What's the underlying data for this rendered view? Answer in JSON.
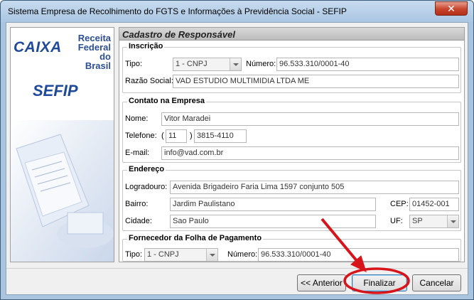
{
  "window": {
    "title": "Sistema Empresa de Recolhimento do FGTS e Informações à Previdência Social - SEFIP",
    "close": "✕"
  },
  "logo": {
    "caixa": "CAIXA",
    "receita_line1": "Receita",
    "receita_line2": "Federal",
    "receita_line3": "do",
    "receita_line4": "Brasil",
    "sefip": "SEFIP"
  },
  "panel": {
    "title": "Cadastro de Responsável"
  },
  "inscricao": {
    "legend": "Inscrição",
    "tipo_label": "Tipo:",
    "tipo_value": "1 - CNPJ",
    "numero_label": "Número:",
    "numero_value": "96.533.310/0001-40",
    "razao_label": "Razão Social:",
    "razao_value": "VAD ESTUDIO MULTIMIDIA LTDA ME"
  },
  "contato": {
    "legend": "Contato na Empresa",
    "nome_label": "Nome:",
    "nome_value": "Vitor Maradei",
    "telefone_label": "Telefone:",
    "paren_open": "(",
    "ddd_value": "11",
    "paren_close": ")",
    "telefone_value": "3815-4110",
    "email_label": "E-mail:",
    "email_value": "info@vad.com.br"
  },
  "endereco": {
    "legend": "Endereço",
    "logradouro_label": "Logradouro:",
    "logradouro_value": "Avenida Brigadeiro Faria Lima 1597 conjunto 505",
    "bairro_label": "Bairro:",
    "bairro_value": "Jardim Paulistano",
    "cep_label": "CEP:",
    "cep_value": "01452-001",
    "cidade_label": "Cidade:",
    "cidade_value": "Sao Paulo",
    "uf_label": "UF:",
    "uf_value": "SP"
  },
  "fornecedor": {
    "legend": "Fornecedor da Folha de Pagamento",
    "tipo_label": "Tipo:",
    "tipo_value": "1 - CNPJ",
    "numero_label": "Número:",
    "numero_value": "96.533.310/0001-40"
  },
  "buttons": {
    "anterior": "<< Anterior",
    "finalizar": "Finalizar",
    "cancelar": "Cancelar"
  },
  "annotation_color": "#d7141a"
}
